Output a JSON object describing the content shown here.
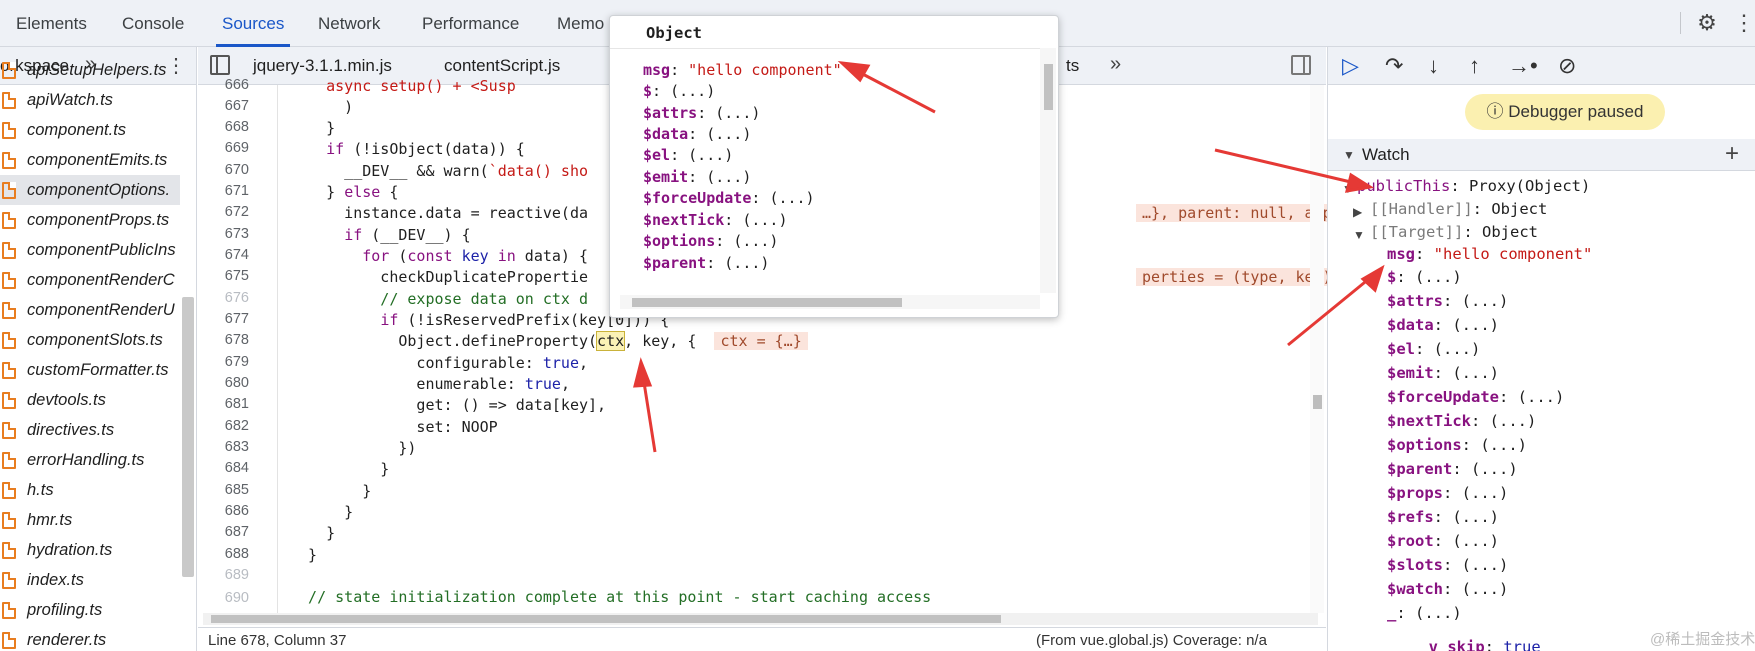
{
  "top_tabs": [
    "Elements",
    "Console",
    "Sources",
    "Network",
    "Performance",
    "Memo"
  ],
  "top_active_tab": "Sources",
  "navigator": {
    "header": "orkspace",
    "files": [
      "apiSetupHelpers.ts",
      "apiWatch.ts",
      "component.ts",
      "componentEmits.ts",
      "componentOptions.",
      "componentProps.ts",
      "componentPublicIns",
      "componentRenderC",
      "componentRenderU",
      "componentSlots.ts",
      "customFormatter.ts",
      "devtools.ts",
      "directives.ts",
      "errorHandling.ts",
      "h.ts",
      "hmr.ts",
      "hydration.ts",
      "index.ts",
      "profiling.ts",
      "renderer.ts"
    ]
  },
  "editor": {
    "tabs": [
      "jquery-3.1.1.min.js",
      "contentScript.js",
      "ts"
    ],
    "lines": [
      {
        "n": "666",
        "faint": false
      },
      {
        "n": "667",
        "faint": false
      },
      {
        "n": "668",
        "faint": false
      },
      {
        "n": "669",
        "faint": false
      },
      {
        "n": "670",
        "faint": false
      },
      {
        "n": "671",
        "faint": false
      },
      {
        "n": "672",
        "faint": false
      },
      {
        "n": "673",
        "faint": false
      },
      {
        "n": "674",
        "faint": false
      },
      {
        "n": "675",
        "faint": false
      },
      {
        "n": "676",
        "faint": true
      },
      {
        "n": "677",
        "faint": false
      },
      {
        "n": "678",
        "faint": false
      },
      {
        "n": "679",
        "faint": false
      },
      {
        "n": "680",
        "faint": false
      },
      {
        "n": "681",
        "faint": false
      },
      {
        "n": "682",
        "faint": false
      },
      {
        "n": "683",
        "faint": false
      },
      {
        "n": "684",
        "faint": false
      },
      {
        "n": "685",
        "faint": false
      },
      {
        "n": "686",
        "faint": false
      },
      {
        "n": "687",
        "faint": false
      },
      {
        "n": "688",
        "faint": false
      },
      {
        "n": "689",
        "faint": true
      },
      {
        "n": "690",
        "faint": true
      }
    ],
    "code": {
      "l666": "    async setup() + <Susp",
      "l667": "      )",
      "l668": "    }",
      "l669_a": "    ",
      "l669_kw": "if",
      "l669_b": " (!isObject(data)) {",
      "l670_a": "      __DEV__ && warn(",
      "l670_s": "`data() sho",
      "l671_a": "    } ",
      "l671_kw": "else",
      "l671_b": " {",
      "l672": "      instance.data = reactive(da",
      "l672_hint": "…}, parent: null, appConte",
      "l673_a": "      ",
      "l673_kw": "if",
      "l673_b": " (__DEV__) {",
      "l674_a": "        ",
      "l674_kw": "for",
      "l674_b": " (",
      "l674_kw2": "const",
      "l674_c": " key ",
      "l674_kw3": "in",
      "l674_d": " data) {",
      "l675": "          checkDuplicatePropertie",
      "l675_hint": "perties = (type, key) => {",
      "l676": "          // expose data on ctx d",
      "l677_a": "          ",
      "l677_kw": "if",
      "l677_b": " (!isReservedPrefix(key[0])) {",
      "l678_a": "            Object.defineProperty(",
      "l678_ctx": "ctx",
      "l678_b": ", key, {",
      "l678_hint": "ctx = {…}",
      "l679_a": "              configurable: ",
      "l679_v": "true",
      "l679_b": ",",
      "l680_a": "              enumerable: ",
      "l680_v": "true",
      "l680_b": ",",
      "l681": "              get: () => data[key],",
      "l682": "              set: NOOP",
      "l683": "            })",
      "l684": "          }",
      "l685": "        }",
      "l686": "      }",
      "l687": "    }",
      "l688": "  }",
      "l690": "  // state initialization complete at this point - start caching access"
    },
    "status_left": "Line 678, Column 37",
    "status_right": "(From vue.global.js) Coverage: n/a"
  },
  "popover": {
    "title": "Object",
    "rows": [
      {
        "key": "msg",
        "value": "\"hello component\"",
        "is_string": true
      },
      {
        "key": "$",
        "value": "(...)"
      },
      {
        "key": "$attrs",
        "value": "(...)"
      },
      {
        "key": "$data",
        "value": "(...)"
      },
      {
        "key": "$el",
        "value": "(...)"
      },
      {
        "key": "$emit",
        "value": "(...)"
      },
      {
        "key": "$forceUpdate",
        "value": "(...)"
      },
      {
        "key": "$nextTick",
        "value": "(...)"
      },
      {
        "key": "$options",
        "value": "(...)"
      },
      {
        "key": "$parent",
        "value": "(...)"
      }
    ]
  },
  "debugger": {
    "paused_text": "Debugger paused",
    "watch_title": "Watch",
    "root_key": "publicThis",
    "root_value": "Proxy(Object)",
    "handler_key": "[[Handler]]",
    "handler_value": "Object",
    "target_key": "[[Target]]",
    "target_value": "Object",
    "msg_key": "msg",
    "msg_value": "\"hello component\"",
    "props": [
      {
        "key": "$",
        "value": "(...)"
      },
      {
        "key": "$attrs",
        "value": "(...)"
      },
      {
        "key": "$data",
        "value": "(...)"
      },
      {
        "key": "$el",
        "value": "(...)"
      },
      {
        "key": "$emit",
        "value": "(...)"
      },
      {
        "key": "$forceUpdate",
        "value": "(...)"
      },
      {
        "key": "$nextTick",
        "value": "(...)"
      },
      {
        "key": "$options",
        "value": "(...)"
      },
      {
        "key": "$parent",
        "value": "(...)"
      },
      {
        "key": "$props",
        "value": "(...)"
      },
      {
        "key": "$refs",
        "value": "(...)"
      },
      {
        "key": "$root",
        "value": "(...)"
      },
      {
        "key": "$slots",
        "value": "(...)"
      },
      {
        "key": "$watch",
        "value": "(...)"
      },
      {
        "key": "_",
        "value": "(...)"
      },
      {
        "key": "__v_skip",
        "value": "true"
      }
    ]
  },
  "watermark": "@稀土掘金技术社区",
  "icons": {
    "settings": "gear-icon",
    "resume": "resume-icon",
    "step_over": "step-over-icon",
    "step_into": "step-into-icon",
    "step_out": "step-out-icon",
    "step": "step-icon",
    "deactivate": "deactivate-breakpoints-icon",
    "info": "info-icon"
  },
  "colors": {
    "accent": "#1a57c8",
    "annotation_arrow": "#e53935",
    "paused_banner": "#fbf0b0",
    "property_key": "#881280",
    "string_value": "#c41a16"
  }
}
